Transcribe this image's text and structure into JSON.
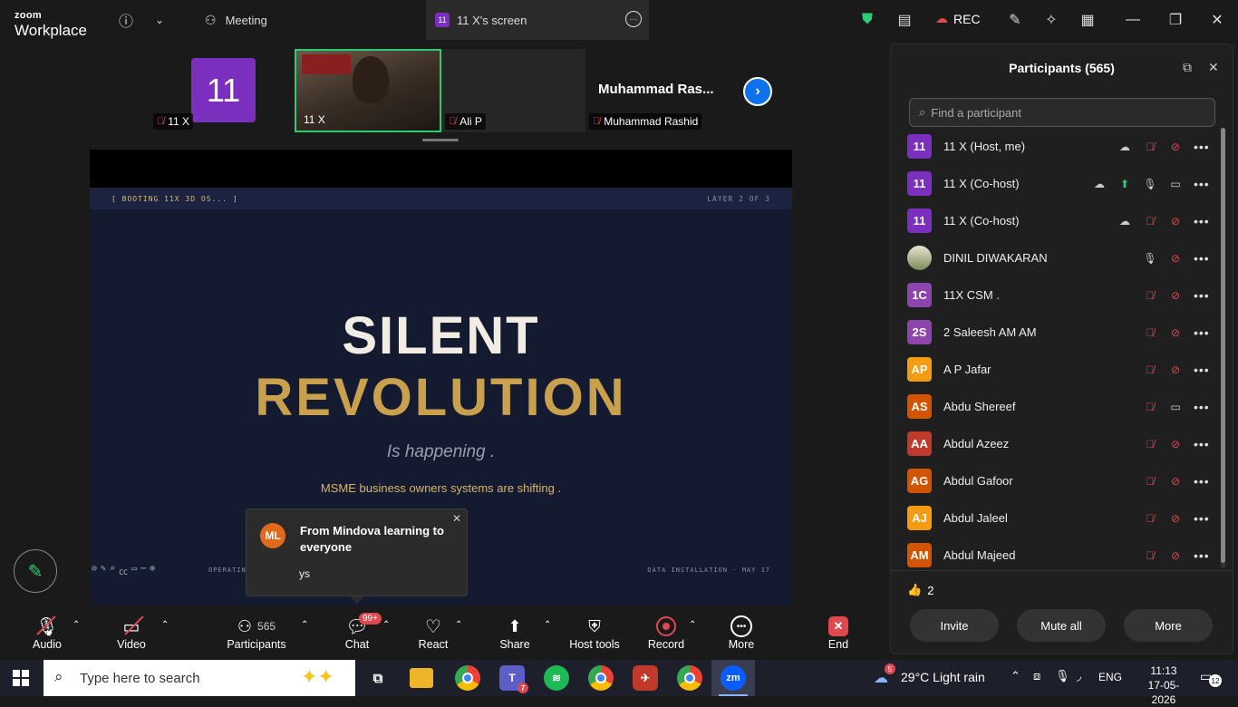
{
  "titlebar": {
    "logo_top": "zoom",
    "logo_bottom": "Workplace",
    "meeting_tab": "Meeting",
    "screen_tab_badge": "11",
    "screen_tab": "11 X's screen",
    "rec_label": "REC"
  },
  "video_strip": {
    "tiles": [
      {
        "avatar": "11",
        "name": "11 X"
      },
      {
        "name": "11 X"
      },
      {
        "name": "Ali P"
      },
      {
        "big_name": "Muhammad  Ras...",
        "name": "Muhammad Rashid"
      }
    ]
  },
  "shared_screen": {
    "booting": "[ BOOTING 11X 3D OS... ]",
    "layer": "LAYER 2 OF 3",
    "headline1": "SILENT",
    "headline2": "REVOLUTION",
    "subtitle": "Is happening .",
    "tagline": "MSME business owners systems are shifting .",
    "footer_left": "OPERATING",
    "footer_right": "DATA INSTALLATION  ·  MAY 17"
  },
  "chat_popup": {
    "avatar": "ML",
    "title": "From Mindova learning to everyone",
    "message": "ys"
  },
  "toolbar": {
    "audio": "Audio",
    "video": "Video",
    "participants": "Participants",
    "participants_count": "565",
    "chat": "Chat",
    "chat_badge": "99+",
    "react": "React",
    "share": "Share",
    "host_tools": "Host tools",
    "record": "Record",
    "more": "More",
    "end": "End"
  },
  "panel": {
    "title": "Participants (565)",
    "search_placeholder": "Find a participant",
    "participants": [
      {
        "initials": "11",
        "color": "#7b2fbe",
        "name": "11 X (Host, me)"
      },
      {
        "initials": "11",
        "color": "#7b2fbe",
        "name": "11 X (Co-host)"
      },
      {
        "initials": "11",
        "color": "#7b2fbe",
        "name": "11 X (Co-host)"
      },
      {
        "initials": "",
        "color": "#9aa27a",
        "name": "DINIL DIWAKARAN"
      },
      {
        "initials": "1C",
        "color": "#8e44ad",
        "name": "11X CSM ."
      },
      {
        "initials": "2S",
        "color": "#8e44ad",
        "name": "2 Saleesh AM AM"
      },
      {
        "initials": "AP",
        "color": "#f39c12",
        "name": "A P Jafar"
      },
      {
        "initials": "AS",
        "color": "#d35400",
        "name": "Abdu Shereef"
      },
      {
        "initials": "AA",
        "color": "#c0392b",
        "name": "Abdul Azeez"
      },
      {
        "initials": "AG",
        "color": "#d35400",
        "name": "Abdul Gafoor"
      },
      {
        "initials": "AJ",
        "color": "#f39c12",
        "name": "Abdul Jaleel"
      },
      {
        "initials": "AM",
        "color": "#d35400",
        "name": "Abdul Majeed"
      }
    ],
    "reaction_count": "2",
    "invite": "Invite",
    "mute_all": "Mute all",
    "more": "More"
  },
  "taskbar": {
    "search_placeholder": "Type here to search",
    "teams_badge": "7",
    "weather_badge": "5",
    "weather": "29°C  Light rain",
    "lang": "ENG",
    "time": "11:13",
    "date": "17-05-2026",
    "notif_count": "12"
  }
}
